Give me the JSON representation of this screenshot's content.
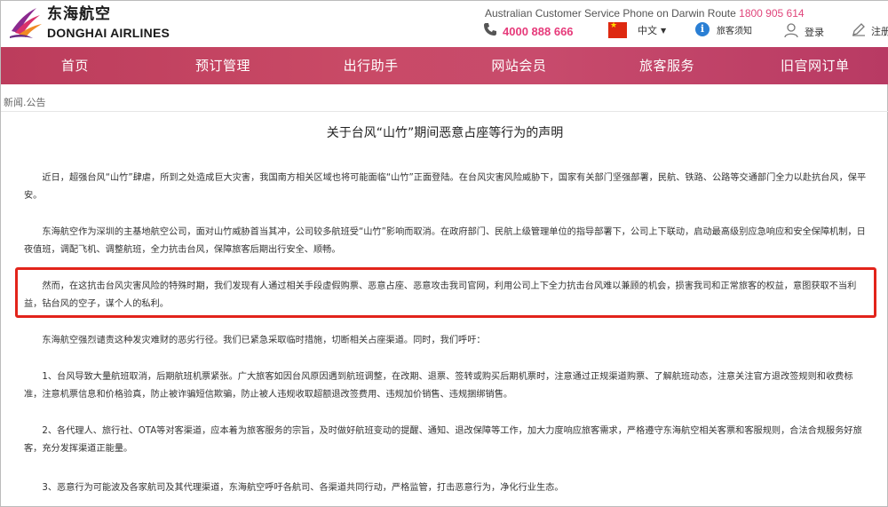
{
  "header": {
    "logo_cn": "东海航空",
    "logo_en": "DONGHAI AIRLINES",
    "cs_phone_label": "Australian Customer Service Phone on Darwin Route",
    "cs_phone_number": "1800 905 614",
    "hotline": "4000 888 666",
    "language": "中文",
    "notice": "旅客须知",
    "login": "登录",
    "register": "注册",
    "colors": {
      "brand": "#c54868",
      "hotline": "#e63a7a"
    }
  },
  "nav": {
    "items": [
      "首页",
      "预订管理",
      "出行助手",
      "网站会员",
      "旅客服务",
      "旧官网订单"
    ]
  },
  "breadcrumb": "新闻.公告",
  "article": {
    "title": "关于台风“山竹”期间恶意占座等行为的声明",
    "paragraphs": [
      "近日，超强台风“山竹”肆虐，所到之处造成巨大灾害，我国南方相关区域也将可能面临“山竹”正面登陆。在台风灾害风险威胁下，国家有关部门坚强部署，民航、铁路、公路等交通部门全力以赴抗台风，保平安。",
      "东海航空作为深圳的主基地航空公司，面对山竹威胁首当其冲，公司较多航班受“山竹”影响而取消。在政府部门、民航上级管理单位的指导部署下，公司上下联动，启动最高级别应急响应和安全保障机制，日夜值班，调配飞机、调整航班，全力抗击台风，保障旅客后期出行安全、顺畅。",
      "然而，在这抗击台风灾害风险的特殊时期，我们发现有人通过相关手段虚假购票、恶意占座、恶意攻击我司官网，利用公司上下全力抗击台风难以兼顾的机会，损害我司和正常旅客的权益，意图获取不当利益，钻台风的空子，谋个人的私利。",
      "东海航空强烈谴责这种发灾难财的恶劣行径。我们已紧急采取临时措施，切断相关占座渠道。同时，我们呼吁：",
      "1、台风导致大量航班取消，后期航班机票紧张。广大旅客如因台风原因遇到航班调整，在改期、退票、签转或购买后期机票时，注意通过正规渠道购票、了解航班动态，注意关注官方退改签规则和收费标准，注意机票信息和价格验真，防止被诈骗短信欺骗，防止被人违规收取超额退改签费用、违规加价销售、违规捆绑销售。",
      "2、各代理人、旅行社、OTA等对客渠道，应本着为旅客服务的宗旨，及时做好航班变动的提醒、通知、退改保障等工作，加大力度响应旅客需求，严格遵守东海航空相关客票和客服规则，合法合规服务好旅客，充分发挥渠道正能量。",
      "3、恶意行为可能波及各家航司及其代理渠道，东海航空呼吁各航司、各渠道共同行动，严格监管，打击恶意行为，净化行业生态。"
    ],
    "highlight_color": "#e2241b"
  }
}
